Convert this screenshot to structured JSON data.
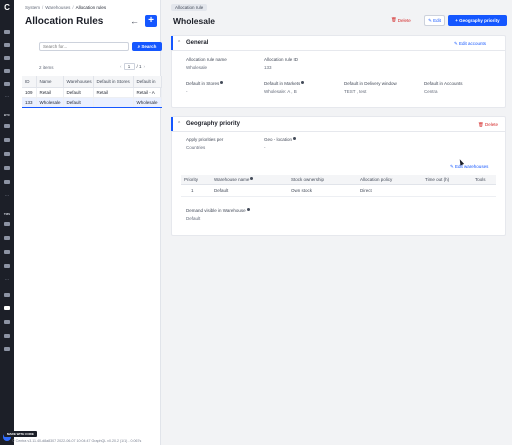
{
  "rail": {
    "logo": "C",
    "section_btc": "BTC",
    "section_tms": "TMS",
    "more": "...",
    "icons": [
      "home-icon",
      "orders-icon",
      "products-icon",
      "tags-icon",
      "customers-icon",
      "stores-icon",
      "reports-icon",
      "settings-icon"
    ]
  },
  "breadcrumb": {
    "system": "System",
    "warehouses": "Warehouses",
    "current": "Allocation rules",
    "separator": "/"
  },
  "left": {
    "title": "Allocation Rules",
    "back_icon": "←",
    "add_icon": "+",
    "search": {
      "placeholder": "Search for...",
      "button": "Search"
    },
    "items_count": "2 items",
    "pager": {
      "prev": "‹",
      "page": "1",
      "total": "/ 1",
      "next": "›"
    },
    "table": {
      "headers": [
        "ID",
        "Name",
        "Warehouses",
        "Default in Stores",
        "Default in"
      ],
      "rows": [
        [
          "109",
          "Retail",
          "Default",
          "Retail",
          "Retail - A"
        ],
        [
          "133",
          "Wholesale",
          "Default",
          "",
          "Wholesale"
        ]
      ]
    },
    "footer_badge": "MADE WITH CODE",
    "footer_version": "© Centra v3.11.40-d8a8307 2022-06-07 10:04:47 GraphQL v0.20.2 (1/1) - 0.067s"
  },
  "main": {
    "tab": "Allocation rule",
    "title": "Wholesale",
    "delete": "Delete",
    "edit": "Edit",
    "geography_button": "+ Geography priority",
    "general": {
      "title": "General",
      "edit_link": "Edit accounts",
      "fields": [
        {
          "label": "Allocation rule name",
          "value": "Wholesale"
        },
        {
          "label": "Allocation rule ID",
          "value": "133"
        },
        {
          "label": "Default in Stores",
          "value": "-"
        },
        {
          "label": "Default in Markets",
          "value": "Wholesale: A , B"
        },
        {
          "label": "Default in Delivery window",
          "value": "TEST , test"
        },
        {
          "label": "Default in Accounts",
          "value": "Centra"
        }
      ]
    },
    "geography": {
      "title": "Geography priority",
      "delete": "Delete",
      "apply_label": "Apply priorities per",
      "apply_value": "Countries",
      "geo_label": "Geo - location",
      "geo_value": "-",
      "edit_warehouses": "Edit warehouses",
      "table": {
        "headers": [
          "Priority",
          "Warehouse name",
          "Stock ownership",
          "Allocation policy",
          "Time out (h)",
          "Tools"
        ],
        "rows": [
          [
            "1",
            "Default",
            "Own stock",
            "Direct",
            "",
            ""
          ]
        ]
      },
      "demand_label": "Demand visible in Warehouse",
      "demand_value": "Default"
    }
  },
  "colors": {
    "primary": "#1557ff",
    "danger": "#d42a2a",
    "rail": "#1c1f28"
  }
}
